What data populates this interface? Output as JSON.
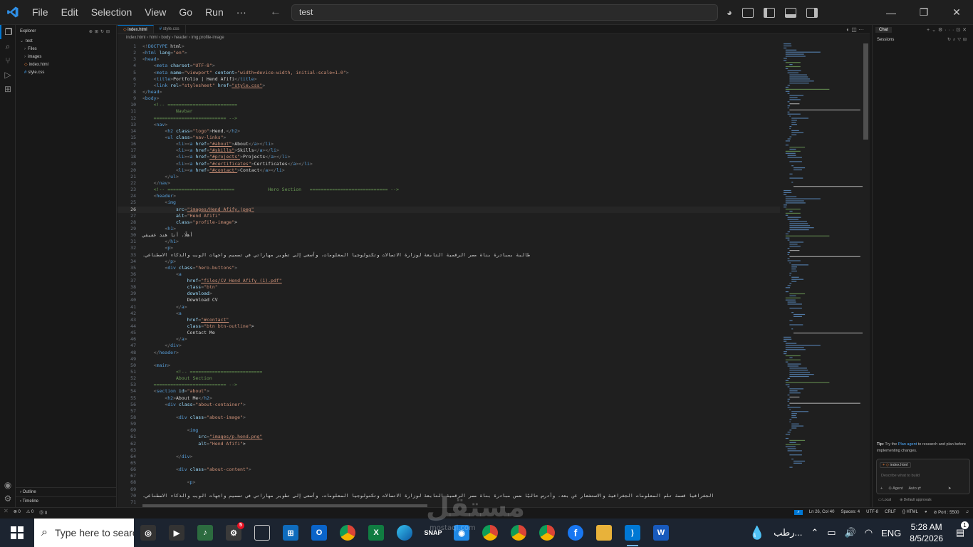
{
  "titlebar": {
    "menu": [
      "File",
      "Edit",
      "Selection",
      "View",
      "Go",
      "Run",
      "···"
    ],
    "search_text": "test",
    "window_controls": [
      "—",
      "❐",
      "✕"
    ]
  },
  "sidebar": {
    "title": "Explorer",
    "root": "test",
    "items": [
      {
        "label": "Files",
        "type": "folder"
      },
      {
        "label": "images",
        "type": "folder"
      },
      {
        "label": "index.html",
        "type": "html"
      },
      {
        "label": "style.css",
        "type": "css"
      }
    ],
    "outline": "Outline",
    "timeline": "Timeline"
  },
  "editor": {
    "tabs": [
      {
        "label": "index.html",
        "active": true
      },
      {
        "label": "style.css",
        "active": false
      }
    ],
    "breadcrumb": "index.html › html › body › header › img.profile-image",
    "current_line": 26,
    "lines": [
      {
        "n": "1",
        "text": "<!DOCTYPE html>"
      },
      {
        "n": "2",
        "text": "<html lang=\"en\">"
      },
      {
        "n": "3",
        "text": "<head>"
      },
      {
        "n": "4",
        "text": "    <meta charset=\"UTF-8\">"
      },
      {
        "n": "5",
        "text": "    <meta name=\"viewport\" content=\"width=device-width, initial-scale=1.0\">"
      },
      {
        "n": "6",
        "text": "    <title>Portfolio | Hend Afifi</title>"
      },
      {
        "n": "7",
        "text": "    <link rel=\"stylesheet\" href=\"style.css\">"
      },
      {
        "n": "8",
        "text": "</head>"
      },
      {
        "n": "9",
        "text": "<body>"
      },
      {
        "n": "10",
        "text": "    <!-- ========================="
      },
      {
        "n": "11",
        "text": "            Navbar"
      },
      {
        "n": "12",
        "text": "    ========================== -->"
      },
      {
        "n": "13",
        "text": "    <nav>"
      },
      {
        "n": "14",
        "text": "        <h2 class=\"logo\">Hend.</h2>"
      },
      {
        "n": "15",
        "text": "        <ul class=\"nav-links\">"
      },
      {
        "n": "16",
        "text": "            <li><a href=\"#about\">About</a></li>"
      },
      {
        "n": "17",
        "text": "            <li><a href=\"#skills\">Skills</a></li>"
      },
      {
        "n": "18",
        "text": "            <li><a href=\"#projects\">Projects</a></li>"
      },
      {
        "n": "19",
        "text": "            <li><a href=\"#certificates\">Certificates</a></li>"
      },
      {
        "n": "20",
        "text": "            <li><a href=\"#contact\">Contact</a></li>"
      },
      {
        "n": "21",
        "text": "        </ul>"
      },
      {
        "n": "22",
        "text": "    </nav>"
      },
      {
        "n": "23",
        "text": "    <!-- ========================            Hero Section   ============================ -->"
      },
      {
        "n": "24",
        "text": "    <header>"
      },
      {
        "n": "25",
        "text": "        <img"
      },
      {
        "n": "26",
        "text": "            src=\"images/Hend Afify.jpeg\""
      },
      {
        "n": "27",
        "text": "            alt=\"Hend Afifi\""
      },
      {
        "n": "28",
        "text": "            class=\"profile-image\">"
      },
      {
        "n": "29",
        "text": "        <h1>"
      },
      {
        "n": "30",
        "text": "            أهلًا، أنا هند عفيفي"
      },
      {
        "n": "31",
        "text": "        </h1>"
      },
      {
        "n": "32",
        "text": "        <p>"
      },
      {
        "n": "33",
        "text": "            طالبة بمبادرة بناة مصر الرقمية التابعة لوزارة الاتصالات وتكنولوجيا المعلومات، وأسعى إلى تطوير مهاراتي في تصميم واجهات الويب والذكاء الاصطناعي."
      },
      {
        "n": "34",
        "text": "        </p>"
      },
      {
        "n": "35",
        "text": "        <div class=\"hero-buttons\">"
      },
      {
        "n": "36",
        "text": "            <a"
      },
      {
        "n": "37",
        "text": "                href=\"files/CV Hend Afify (1).pdf\""
      },
      {
        "n": "38",
        "text": "                class=\"btn\""
      },
      {
        "n": "39",
        "text": "                download>"
      },
      {
        "n": "40",
        "text": "                Download CV"
      },
      {
        "n": "41",
        "text": "            </a>"
      },
      {
        "n": "42",
        "text": "            <a"
      },
      {
        "n": "43",
        "text": "                href=\"#contact\""
      },
      {
        "n": "44",
        "text": "                class=\"btn btn-outline\">"
      },
      {
        "n": "45",
        "text": "                Contact Me"
      },
      {
        "n": "46",
        "text": "            </a>"
      },
      {
        "n": "47",
        "text": "        </div>"
      },
      {
        "n": "48",
        "text": "    </header>"
      },
      {
        "n": "49",
        "text": ""
      },
      {
        "n": "50",
        "text": "    <main>"
      },
      {
        "n": "51",
        "text": "            <!-- =========================="
      },
      {
        "n": "52",
        "text": "            About Section"
      },
      {
        "n": "53",
        "text": "    ========================== -->"
      },
      {
        "n": "54",
        "text": "    <section id=\"about\">"
      },
      {
        "n": "55",
        "text": "        <h2>About Me</h2>"
      },
      {
        "n": "56",
        "text": "        <div class=\"about-container\">"
      },
      {
        "n": "57",
        "text": ""
      },
      {
        "n": "58",
        "text": "            <div class=\"about-image\">"
      },
      {
        "n": "59",
        "text": ""
      },
      {
        "n": "60",
        "text": "                <img"
      },
      {
        "n": "61",
        "text": "                    src=\"images/p.hend.png\""
      },
      {
        "n": "62",
        "text": "                    alt=\"Hend Afifi\">"
      },
      {
        "n": "63",
        "text": ""
      },
      {
        "n": "64",
        "text": "            </div>"
      },
      {
        "n": "65",
        "text": ""
      },
      {
        "n": "66",
        "text": "            <div class=\"about-content\">"
      },
      {
        "n": "67",
        "text": ""
      },
      {
        "n": "68",
        "text": "                <p>"
      },
      {
        "n": "69",
        "text": ""
      },
      {
        "n": "70",
        "text": "                    الجغرافيا قسمة تلم المعلومات الجغرافية والاستشعار عن بعد، وأدرس حاليًا ضمن مبادرة بناة مصر الرقمية التابعة لوزارة الاتصالات وتكنولوجيا المعلومات، وأسعى إلى تطوير مهاراتي في تصميم واجهات الويب والذكاء الاصطناعي."
      },
      {
        "n": "71",
        "text": ""
      }
    ]
  },
  "chat": {
    "tab": "Chat",
    "sessions": "Sessions",
    "tip_prefix": "Tip:",
    "tip_text": "Try the",
    "tip_link": "Plan agent",
    "tip_rest": "to research and plan before implementing changes.",
    "context_chip": "index.html",
    "placeholder": "Describe what to build",
    "agent": "Agent",
    "model": "Auto",
    "footer_local": "Local",
    "footer_approvals": "Default approvals"
  },
  "statusbar": {
    "left": [
      "⊗ 0",
      "⚠ 0",
      "⓪ 0"
    ],
    "position": "Ln 26, Col 40",
    "spaces": "Spaces: 4",
    "encoding": "UTF-8",
    "eol": "CRLF",
    "language": "{} HTML",
    "port": "⊘ Port : 5500"
  },
  "taskbar": {
    "search_placeholder": "Type here to search",
    "weather": "رطب...",
    "lang": "ENG",
    "time": "5:28 AM",
    "date": "8/5/2026",
    "notifications": "1",
    "app_badge": "5",
    "snap_label": "SNAP"
  },
  "watermark": {
    "text": "مستقل",
    "sub": "mostaql.com"
  },
  "colors": {
    "accent": "#0078d4",
    "editor_bg": "#1f1f1f",
    "taskbar_bg": "#1c2430"
  }
}
